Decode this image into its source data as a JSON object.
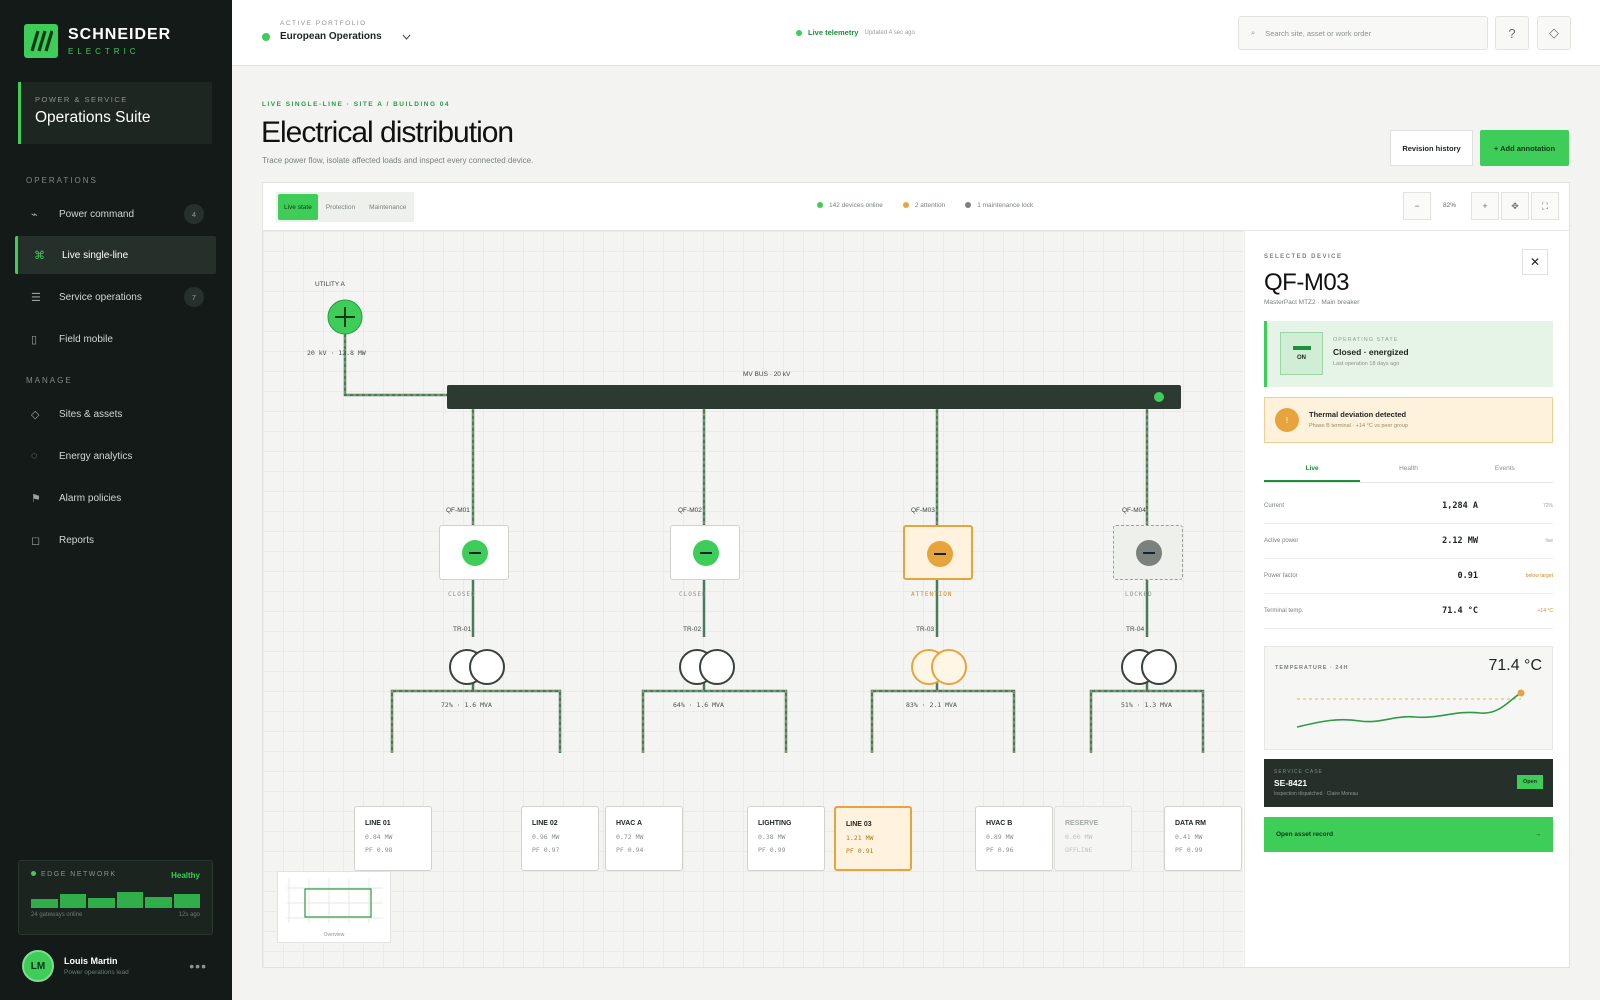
{
  "brand": {
    "name": "SCHNEIDER",
    "sub": "ELECTRIC"
  },
  "suite": {
    "caption": "POWER & SERVICE",
    "name": "Operations Suite"
  },
  "nav": {
    "section_ops": "OPERATIONS",
    "section_manage": "MANAGE",
    "items": [
      {
        "label": "Power command",
        "badge": "4",
        "icon": "bolt-icon"
      },
      {
        "label": "Live single-line",
        "badge": "",
        "icon": "command-icon"
      },
      {
        "label": "Service operations",
        "badge": "7",
        "icon": "list-icon"
      },
      {
        "label": "Field mobile",
        "badge": "",
        "icon": "mobile-icon"
      },
      {
        "label": "Sites & assets",
        "badge": "",
        "icon": "diamond-icon"
      },
      {
        "label": "Energy analytics",
        "badge": "",
        "icon": "circle-icon"
      },
      {
        "label": "Alarm policies",
        "badge": "",
        "icon": "flag-icon"
      },
      {
        "label": "Reports",
        "badge": "",
        "icon": "square-icon"
      }
    ]
  },
  "edge": {
    "label": "EDGE NETWORK",
    "status": "Healthy",
    "bars": [
      0.45,
      0.7,
      0.5,
      0.8,
      0.55,
      0.7
    ],
    "foot_left": "24 gateways online",
    "foot_right": "12s ago"
  },
  "user": {
    "initials": "LM",
    "name": "Louis Martin",
    "role": "Power operations lead"
  },
  "topbar": {
    "portfolio_caption": "ACTIVE PORTFOLIO",
    "portfolio_value": "European Operations",
    "telemetry": "Live telemetry",
    "updated": "Updated 4 sec ago",
    "search_placeholder": "Search site, asset or work order"
  },
  "header": {
    "crumb": "LIVE SINGLE-LINE · SITE A / BUILDING 04",
    "title": "Electrical distribution",
    "subtitle": "Trace power flow, isolate affected loads and inspect every connected device.",
    "revision": "Revision history",
    "add": "+ Add annotation"
  },
  "toolbar": {
    "tabs": [
      "Live state",
      "Protection",
      "Maintenance"
    ],
    "legend": [
      {
        "text": "142 devices online",
        "color": "#3dcd58"
      },
      {
        "text": "2 attention",
        "color": "#e8a43c"
      },
      {
        "text": "1 maintenance lock",
        "color": "#7b817d"
      }
    ],
    "zoom": "82%"
  },
  "diagram": {
    "utility": {
      "label": "UTILITY A",
      "spec": "20 kV · 12.8 MW"
    },
    "bus": "MV BUS · 20 kV",
    "feeders": [
      {
        "breaker": "QF-M01",
        "state": "CLOSED",
        "tr": "TR-01",
        "info": "72% · 1.6 MVA"
      },
      {
        "breaker": "QF-M02",
        "state": "CLOSED",
        "tr": "TR-02",
        "info": "64% · 1.6 MVA"
      },
      {
        "breaker": "QF-M03",
        "state": "ATTENTION",
        "tr": "TR-03",
        "info": "83% · 2.1 MVA"
      },
      {
        "breaker": "QF-M04",
        "state": "LOCKED",
        "tr": "TR-04",
        "info": "51% · 1.3 MVA"
      }
    ],
    "loads": [
      {
        "name": "LINE 01",
        "a": "0.84 MW",
        "b": "PF 0.98"
      },
      {
        "name": "LINE 02",
        "a": "0.96 MW",
        "b": "PF 0.97"
      },
      {
        "name": "HVAC A",
        "a": "0.72 MW",
        "b": "PF 0.94"
      },
      {
        "name": "LIGHTING",
        "a": "0.38 MW",
        "b": "PF 0.99"
      },
      {
        "name": "LINE 03",
        "a": "1.21 MW",
        "b": "PF 0.91"
      },
      {
        "name": "HVAC B",
        "a": "0.89 MW",
        "b": "PF 0.96"
      },
      {
        "name": "RESERVE",
        "a": "0.00 MW",
        "b": "OFFLINE"
      },
      {
        "name": "DATA RM",
        "a": "0.41 MW",
        "b": "PF 0.99"
      }
    ],
    "minimap_label": "Overview"
  },
  "detail": {
    "caption": "SELECTED DEVICE",
    "title": "QF-M03",
    "subtitle": "MasterPact MTZ2 · Main breaker",
    "op_caption": "OPERATING STATE",
    "op_value": "Closed · energized",
    "op_sub": "Last operation 18 days ago",
    "switch_label": "ON",
    "alert_title": "Thermal deviation detected",
    "alert_sub": "Phase B terminal · +14 °C vs peer group",
    "tabs": [
      "Live",
      "Health",
      "Events"
    ],
    "metrics": [
      {
        "label": "Current",
        "value": "1,284 A",
        "extra": "72%"
      },
      {
        "label": "Active power",
        "value": "2.12 MW",
        "extra": "live"
      },
      {
        "label": "Power factor",
        "value": "0.91",
        "extra": "below target"
      },
      {
        "label": "Terminal temp.",
        "value": "71.4 °C",
        "extra": "+14 °C"
      }
    ],
    "temp_caption": "TEMPERATURE · 24H",
    "temp_value": "71.4 °C",
    "case_caption": "SERVICE CASE",
    "case_id": "SE-8421",
    "case_sub": "Inspection dispatched · Claire Moreau",
    "case_btn": "Open",
    "open_record": "Open asset record",
    "open_arrow": "→"
  }
}
